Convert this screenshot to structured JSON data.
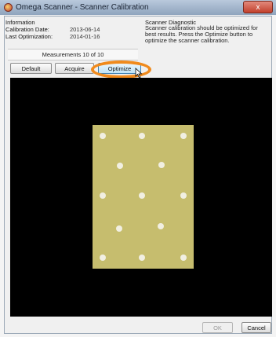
{
  "window": {
    "title": "Omega Scanner - Scanner Calibration",
    "close_label": "x"
  },
  "information": {
    "title": "Information",
    "rows": [
      {
        "label": "Calibration Date:",
        "value": "2013-06-14"
      },
      {
        "label": "Last Optimization:",
        "value": "2014-01-16"
      }
    ]
  },
  "diagnostic": {
    "title": "Scanner Diagnostic",
    "text": "Scanner calibration should be optimized for best results. Press the Optimize button to optimize the scanner calibration."
  },
  "measurements": {
    "label": "Measurements 10 of 10"
  },
  "toolbar": {
    "default_label": "Default",
    "acquire_label": "Acquire",
    "optimize_label": "Optimize"
  },
  "calibration_target": {
    "background_color": "#000000",
    "card_color": "#c6bd6e",
    "dot_color": "#f1efe2",
    "dot_count": 13
  },
  "footer": {
    "ok_label": "OK",
    "cancel_label": "Cancel"
  },
  "colors": {
    "accent_highlight": "#f08a1c",
    "titlebar": "#9fb2c9"
  }
}
